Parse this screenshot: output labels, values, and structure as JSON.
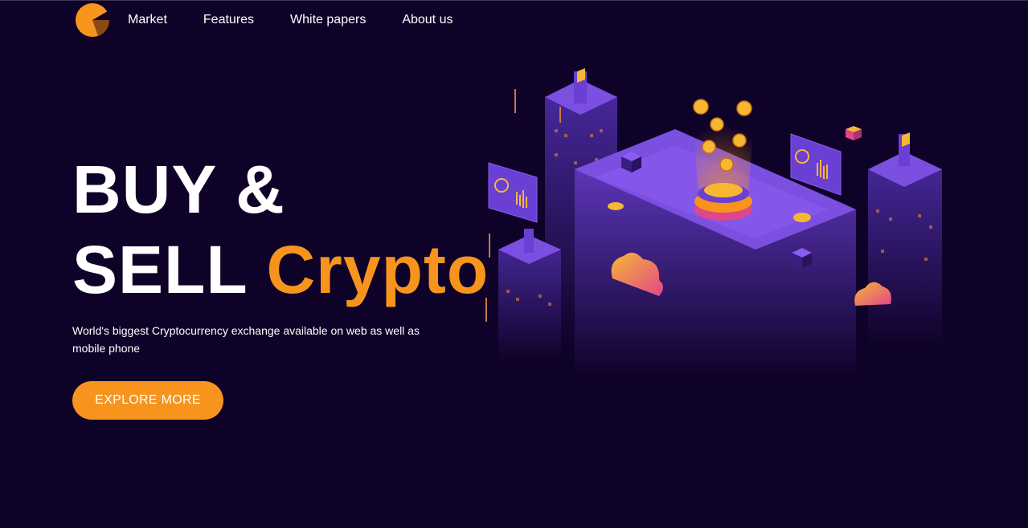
{
  "brand": {
    "logo_icon": "pacman-logo-icon",
    "accent_color": "#f7941d",
    "background_color": "#0f0228"
  },
  "nav": {
    "items": [
      {
        "label": "Market"
      },
      {
        "label": "Features"
      },
      {
        "label": "White papers"
      },
      {
        "label": "About us"
      }
    ]
  },
  "hero": {
    "title_line1": "BUY &",
    "title_line2_prefix": "SELL",
    "title_line2_accent": "Crypto",
    "subtitle": "World's biggest Cryptocurrency exchange available on web as well as mobile phone",
    "cta_label": "EXPLORE MORE"
  },
  "illustration": {
    "icon": "isometric-crypto-city-illustration"
  }
}
